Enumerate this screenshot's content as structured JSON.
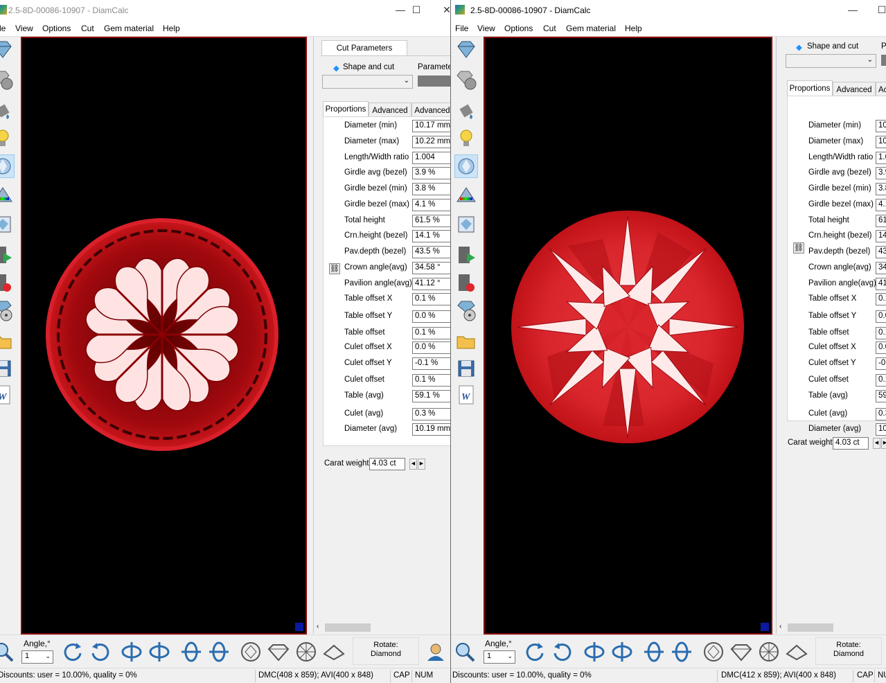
{
  "win1": {
    "title": "2.5-8D-00086-10907 - DiamCalc",
    "menu": [
      "le",
      "View",
      "Options",
      "Cut",
      "Gem material",
      "Help"
    ],
    "panel_tab": "Cut Parameters",
    "shape_label": "Shape and cut",
    "parameter_label": "Parameter",
    "param_tabs": [
      "Proportions",
      "Advanced",
      "Advanced"
    ],
    "rows": [
      {
        "label": "Diameter (min)",
        "value": "10.17 mm"
      },
      {
        "label": "Diameter (max)",
        "value": "10.22 mm"
      },
      {
        "label": "Length/Width ratio",
        "value": "1.004"
      },
      {
        "label": "Girdle avg (bezel)",
        "value": "3.9 %"
      },
      {
        "label": "Girdle bezel (min)",
        "value": "3.8 %"
      },
      {
        "label": "Girdle bezel (max)",
        "value": "4.1 %"
      },
      {
        "label": "Total height",
        "value": "61.5 %"
      },
      {
        "label": "Crn.height (bezel)",
        "value": "14.1 %"
      },
      {
        "label": "Pav.depth (bezel)",
        "value": "43.5 %"
      },
      {
        "label": "Crown angle(avg)",
        "value": "34.58 °"
      },
      {
        "label": "Pavilion angle(avg)",
        "value": "41.12 °"
      },
      {
        "label": "Table offset X",
        "value": "0.1 %"
      },
      {
        "label": "Table offset Y",
        "value": "0.0 %"
      },
      {
        "label": "Table offset",
        "value": "0.1 %"
      },
      {
        "label": "Culet offset X",
        "value": "0.0 %"
      },
      {
        "label": "Culet offset Y",
        "value": "-0.1 %"
      },
      {
        "label": "Culet offset",
        "value": "0.1 %"
      },
      {
        "label": "Table (avg)",
        "value": "59.1 %"
      },
      {
        "label": "Culet (avg)",
        "value": "0.3 %"
      },
      {
        "label": "Diameter (avg)",
        "value": "10.19 mm"
      }
    ],
    "carat_label": "Carat weight",
    "carat_value": "4.03 ct",
    "angle_label": "Angle,°",
    "angle_value": "1",
    "rotate_label": "Rotate:",
    "rotate_value": "Diamond",
    "status": {
      "discounts": "Discounts: user = 10.00%, quality = 0%",
      "dmc": "DMC(408 x 859); AVI(400 x 848)",
      "cap": "CAP",
      "num": "NUM"
    }
  },
  "win2": {
    "title": "2.5-8D-00086-10907 - DiamCalc",
    "menu": [
      "File",
      "View",
      "Options",
      "Cut",
      "Gem material",
      "Help"
    ],
    "shape_label": "Shape and cut",
    "parameter_label": "P",
    "param_tabs": [
      "Proportions",
      "Advanced",
      "Ac"
    ],
    "rows": [
      {
        "label": "Diameter (min)",
        "value": "10"
      },
      {
        "label": "Diameter (max)",
        "value": "10"
      },
      {
        "label": "Length/Width ratio",
        "value": "1.0"
      },
      {
        "label": "Girdle avg (bezel)",
        "value": "3.9"
      },
      {
        "label": "Girdle bezel (min)",
        "value": "3.8"
      },
      {
        "label": "Girdle bezel (max)",
        "value": "4.1"
      },
      {
        "label": "Total height",
        "value": "61"
      },
      {
        "label": "Crn.height (bezel)",
        "value": "14"
      },
      {
        "label": "Pav.depth (bezel)",
        "value": "43"
      },
      {
        "label": "Crown angle(avg)",
        "value": "34"
      },
      {
        "label": "Pavilion angle(avg)",
        "value": "41"
      },
      {
        "label": "Table offset X",
        "value": "0.1"
      },
      {
        "label": "Table offset Y",
        "value": "0.0"
      },
      {
        "label": "Table offset",
        "value": "0.1"
      },
      {
        "label": "Culet offset X",
        "value": "0.0"
      },
      {
        "label": "Culet offset Y",
        "value": "-0."
      },
      {
        "label": "Culet offset",
        "value": "0.1"
      },
      {
        "label": "Table (avg)",
        "value": "59"
      },
      {
        "label": "Culet (avg)",
        "value": "0.3"
      },
      {
        "label": "Diameter (avg)",
        "value": "10"
      }
    ],
    "carat_label": "Carat weight",
    "carat_value": "4.03 ct",
    "angle_label": "Angle,°",
    "angle_value": "1",
    "rotate_label": "Rotate:",
    "rotate_value": "Diamond",
    "status": {
      "discounts": "Discounts: user = 10.00%, quality = 0%",
      "dmc": "DMC(412 x 859); AVI(400 x 848)",
      "cap": "CAP",
      "num": "NU"
    }
  },
  "colors": {
    "gem_red": "#c8161b",
    "viewport_border": "#8b0000",
    "selection_blue": "#0a1aa0"
  },
  "icons": [
    "diamond-icon",
    "gem-sphere-icon",
    "paint-bucket-icon",
    "lightbulb-icon",
    "diamond-view-icon",
    "spectrum-icon",
    "image-icon",
    "video-icon",
    "record-icon",
    "film-reel-icon",
    "open-folder-icon",
    "save-icon",
    "word-icon"
  ]
}
